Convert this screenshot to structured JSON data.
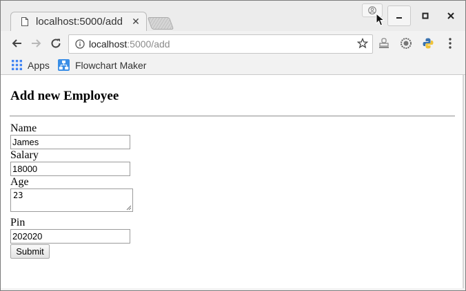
{
  "browser": {
    "tab": {
      "title": "localhost:5000/add"
    },
    "address": {
      "host": "localhost",
      "path": ":5000/add"
    },
    "bookmarks": [
      {
        "label": "Apps",
        "icon": "apps-grid-icon"
      },
      {
        "label": "Flowchart Maker",
        "icon": "flowchart-maker-icon"
      }
    ],
    "colors": {
      "accent": "#4285f4",
      "flowchart": "#3a8ee6"
    }
  },
  "page": {
    "heading": "Add new Employee",
    "fields": {
      "name": {
        "label": "Name",
        "value": "James"
      },
      "salary": {
        "label": "Salary",
        "value": "18000"
      },
      "age": {
        "label": "Age",
        "value": "23"
      },
      "pin": {
        "label": "Pin",
        "value": "202020"
      }
    },
    "submit_label": "Submit"
  }
}
